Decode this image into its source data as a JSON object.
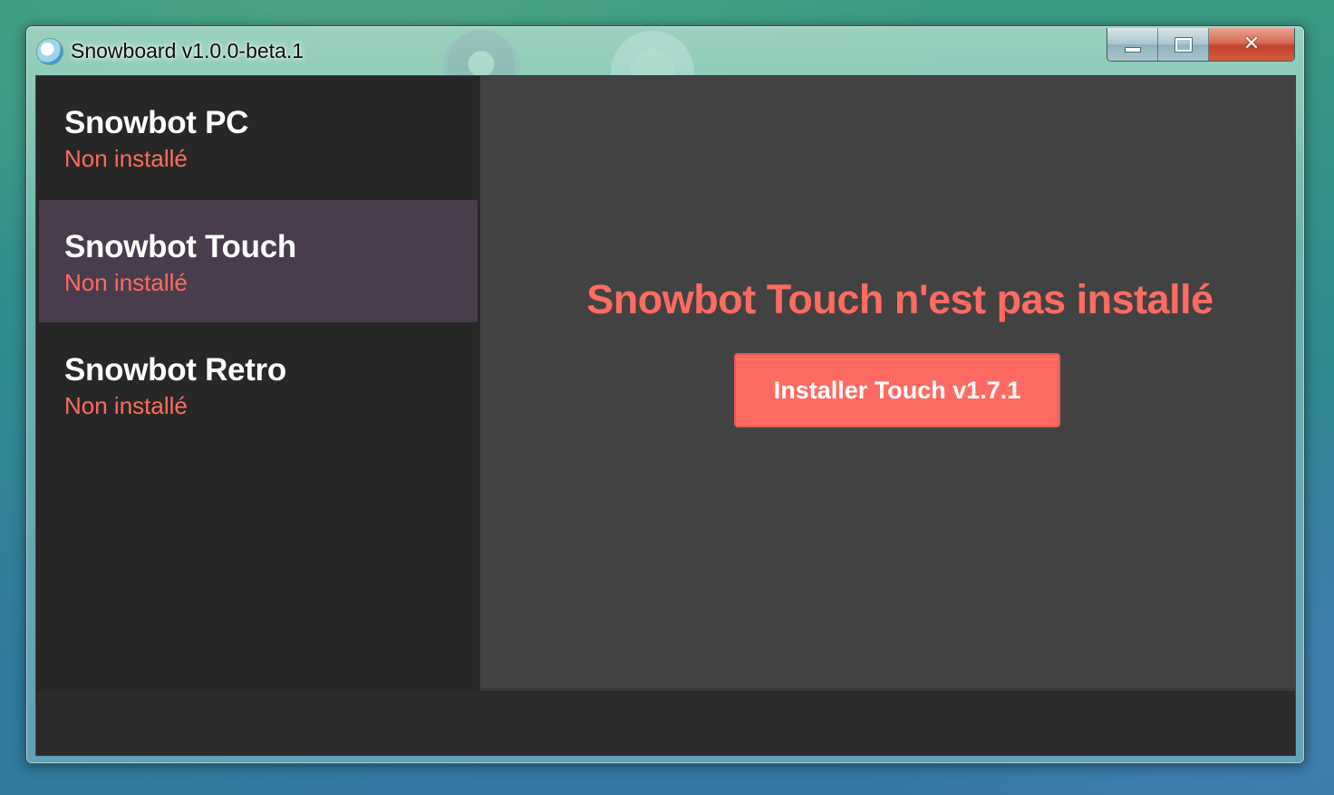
{
  "window": {
    "title": "Snowboard v1.0.0-beta.1",
    "controls": {
      "minimize_icon": "minimize-icon",
      "maximize_icon": "maximize-icon",
      "close_glyph": "✕"
    }
  },
  "sidebar": {
    "items": [
      {
        "name": "Snowbot PC",
        "status": "Non installé",
        "active": false
      },
      {
        "name": "Snowbot Touch",
        "status": "Non installé",
        "active": true
      },
      {
        "name": "Snowbot Retro",
        "status": "Non installé",
        "active": false
      }
    ]
  },
  "main": {
    "heading": "Snowbot Touch n'est pas installé",
    "install_button": "Installer Touch v1.7.1"
  },
  "colors": {
    "accent": "#ff6b61",
    "sidebar_bg": "#272727",
    "sidebar_active_bg": "#483c4d",
    "main_bg": "#424242",
    "button_bg": "#ff6b63"
  }
}
